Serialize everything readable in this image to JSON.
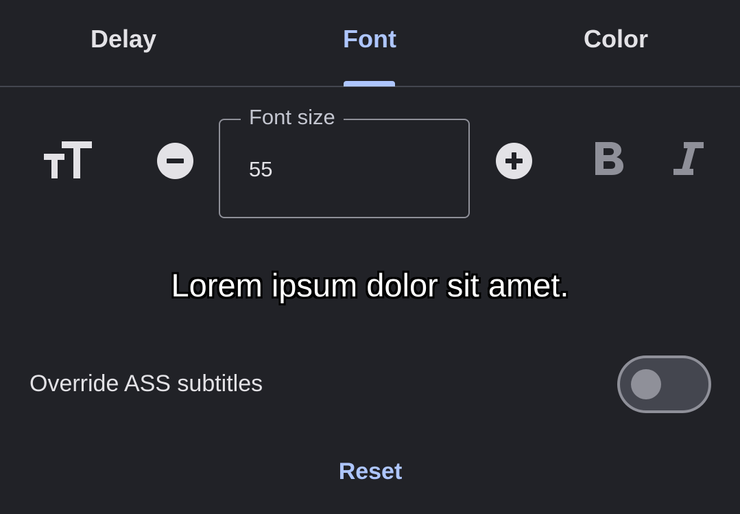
{
  "tabs": [
    {
      "label": "Delay",
      "active": false
    },
    {
      "label": "Font",
      "active": true
    },
    {
      "label": "Color",
      "active": false
    }
  ],
  "font_size": {
    "label": "Font size",
    "value": "55",
    "icon": "text-size-icon",
    "decrease_icon": "minus-circle-icon",
    "increase_icon": "plus-circle-icon"
  },
  "style": {
    "bold_icon": "bold-icon",
    "italic_icon": "italic-icon"
  },
  "preview": {
    "text": "Lorem ipsum dolor sit amet."
  },
  "override": {
    "label": "Override ASS subtitles",
    "enabled": false
  },
  "actions": {
    "reset_label": "Reset"
  },
  "colors": {
    "background": "#212227",
    "accent": "#aec6ff",
    "text": "#e3e2e6",
    "outline": "#8f9099",
    "disabled_icon": "#8f9099"
  }
}
